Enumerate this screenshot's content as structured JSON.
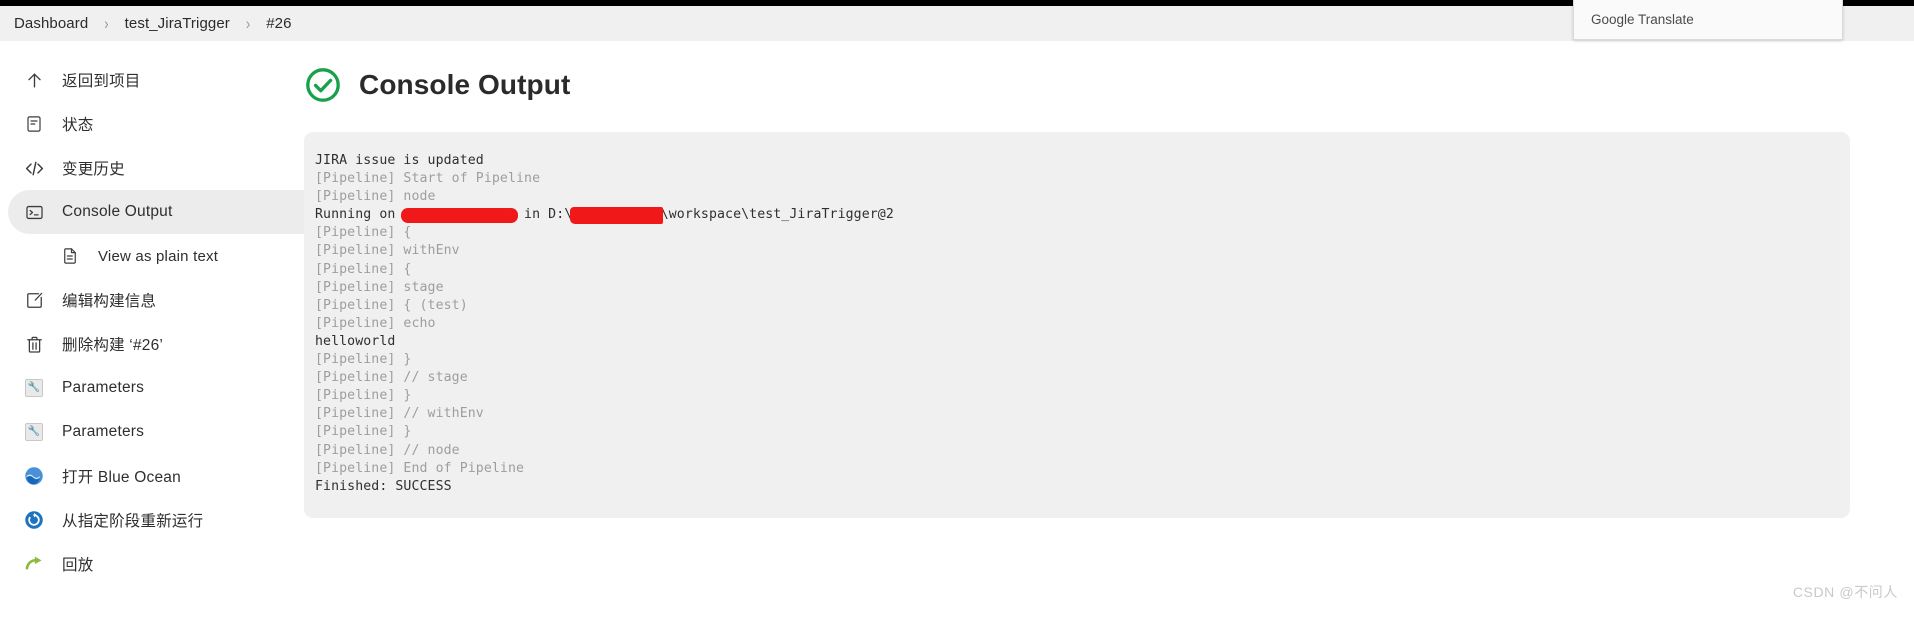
{
  "breadcrumb": {
    "items": [
      {
        "label": "Dashboard"
      },
      {
        "label": "test_JiraTrigger"
      },
      {
        "label": "#26"
      }
    ],
    "separator": "›"
  },
  "popup": {
    "title": "Google Translate"
  },
  "sidebar": {
    "items": [
      {
        "label": "返回到项目",
        "icon": "arrow-up-icon",
        "active": false,
        "sub": false
      },
      {
        "label": "状态",
        "icon": "document-status-icon",
        "active": false,
        "sub": false
      },
      {
        "label": "变更历史",
        "icon": "code-brackets-icon",
        "active": false,
        "sub": false
      },
      {
        "label": "Console Output",
        "icon": "terminal-icon",
        "active": true,
        "sub": false
      },
      {
        "label": "View as plain text",
        "icon": "plain-text-file-icon",
        "active": false,
        "sub": true
      },
      {
        "label": "编辑构建信息",
        "icon": "edit-square-icon",
        "active": false,
        "sub": false
      },
      {
        "label": "删除构建 ‘#26’",
        "icon": "trash-icon",
        "active": false,
        "sub": false
      },
      {
        "label": "Parameters",
        "icon": "parameters-icon",
        "active": false,
        "sub": false
      },
      {
        "label": "Parameters",
        "icon": "parameters-icon",
        "active": false,
        "sub": false
      },
      {
        "label": "打开 Blue Ocean",
        "icon": "blue-ocean-icon",
        "active": false,
        "sub": false
      },
      {
        "label": "从指定阶段重新运行",
        "icon": "restart-stage-icon",
        "active": false,
        "sub": false
      },
      {
        "label": "回放",
        "icon": "replay-icon",
        "active": false,
        "sub": false
      }
    ]
  },
  "main": {
    "title": "Console Output",
    "status_icon": "success-check-circle-icon",
    "status_color": "#18a14a",
    "console": {
      "lines": [
        {
          "text": "JIRA issue is updated",
          "strong": true
        },
        {
          "text": "[Pipeline] Start of Pipeline",
          "strong": false
        },
        {
          "text": "[Pipeline] node",
          "strong": false
        },
        {
          "redacted": true,
          "prefix": "Running on ",
          "redaction1": "xxxxxxxxxxxxxx",
          "middle": " in D:\\",
          "redaction2": "xxxxxxxxxxx",
          "suffix": "\\workspace\\test_JiraTrigger@2",
          "strong": true
        },
        {
          "text": "[Pipeline] {",
          "strong": false
        },
        {
          "text": "[Pipeline] withEnv",
          "strong": false
        },
        {
          "text": "[Pipeline] {",
          "strong": false
        },
        {
          "text": "[Pipeline] stage",
          "strong": false
        },
        {
          "text": "[Pipeline] { (test)",
          "strong": false
        },
        {
          "text": "[Pipeline] echo",
          "strong": false
        },
        {
          "text": "helloworld",
          "strong": true
        },
        {
          "text": "[Pipeline] }",
          "strong": false
        },
        {
          "text": "[Pipeline] // stage",
          "strong": false
        },
        {
          "text": "[Pipeline] }",
          "strong": false
        },
        {
          "text": "[Pipeline] // withEnv",
          "strong": false
        },
        {
          "text": "[Pipeline] }",
          "strong": false
        },
        {
          "text": "[Pipeline] // node",
          "strong": false
        },
        {
          "text": "[Pipeline] End of Pipeline",
          "strong": false
        },
        {
          "text": "Finished: SUCCESS",
          "strong": true
        }
      ]
    }
  },
  "watermark": {
    "text": "CSDN @不问人"
  }
}
